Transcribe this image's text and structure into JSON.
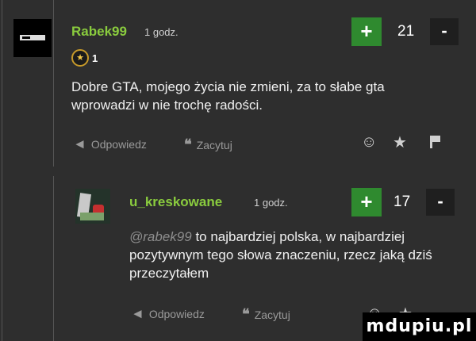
{
  "comments": [
    {
      "username": "Rabek99",
      "time": "1 godz.",
      "votes": "21",
      "badge_count": "1",
      "text": "Dobre GTA, mojego życia nie zmieni, za to słabe gta wprowadzi w nie trochę radości.",
      "reply_label": "Odpowiedz",
      "quote_label": "Zacytuj"
    },
    {
      "username": "u_kreskowane",
      "time": "1 godz.",
      "votes": "17",
      "mention": "@rabek99",
      "text": "to najbardziej polska, w najbardziej pozytywnym tego słowa znaczeniu, rzecz jaką dziś przeczytałem",
      "reply_label": "Odpowiedz",
      "quote_label": "Zacytuj"
    }
  ],
  "vote_plus_label": "+",
  "vote_minus_label": "-",
  "watermark": "mdupiu.pl",
  "icons": [
    "reply-icon",
    "quote-icon",
    "emoji-icon",
    "star-icon",
    "flag-icon"
  ]
}
